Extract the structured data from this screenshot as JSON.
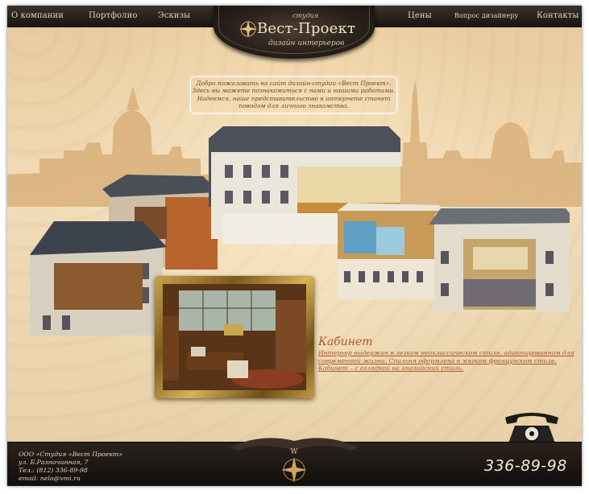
{
  "nav": {
    "left": [
      "О компании",
      "Портфолио",
      "Эскизы"
    ],
    "right": [
      "Цены",
      "Вопрос дизайнеру",
      "Контакты"
    ]
  },
  "logo": {
    "studio": "студия",
    "title": "Вест-Проект",
    "subtitle": "дизайн интерьеров"
  },
  "welcome": {
    "line1": "Добро пожаловать на сайт дизайн-студии «Вест Проект».",
    "line2": "Здесь вы можете познакомиться с нами и нашими работами.",
    "line3": "Надеемся, наше представительство в интернете станет",
    "line4": "поводом для личного знакомства."
  },
  "section": {
    "title": "Кабинет",
    "text": "Интерьер выдержан в легком неоклассическом стиле, адаптированном для современной жизни. Спальня оформлена в мягком французском стиле. Кабинет – с оглядкой на английский стиль."
  },
  "footer": {
    "company": "ООО «Студия «Вест Проект»",
    "address": "ул. Б.Разночинная, 7",
    "tel": "Тел.: (812) 336-89-98",
    "email": "email: nela@vmi.ru",
    "phone": "336-89-98",
    "compass_letter": "W"
  },
  "colors": {
    "bg": "#efd6ad",
    "bar": "#1a1411",
    "accent_text": "#a9562b"
  },
  "icons": [
    "compass-icon",
    "telephone-icon"
  ]
}
